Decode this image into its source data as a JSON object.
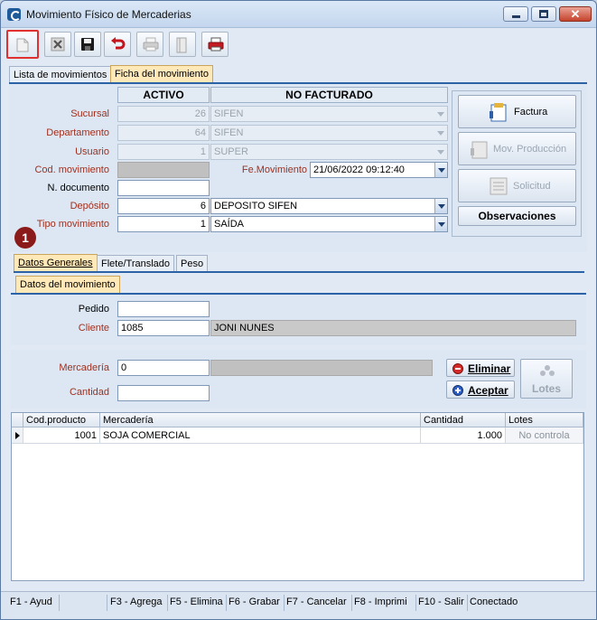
{
  "window": {
    "title": "Movimiento Físico de Mercaderias",
    "close_glyph": "✕"
  },
  "toolbar": {
    "buttons": [
      {
        "name": "new-document-icon",
        "selected": true
      },
      {
        "name": "delete-icon"
      },
      {
        "name": "save-icon"
      },
      {
        "name": "undo-icon"
      },
      {
        "name": "print-icon"
      },
      {
        "name": "book-icon"
      },
      {
        "name": "print-report-icon"
      }
    ]
  },
  "main_tabs": [
    "Lista de movimientos",
    "Ficha del movimiento"
  ],
  "header": {
    "status": "ACTIVO",
    "billing_status": "NO FACTURADO"
  },
  "form": {
    "sucursal": {
      "label": "Sucursal",
      "code": "26",
      "name": "SIFEN"
    },
    "departamento": {
      "label": "Departamento",
      "code": "64",
      "name": "SIFEN"
    },
    "usuario": {
      "label": "Usuario",
      "code": "1",
      "name": "SUPER"
    },
    "cod_movimiento": {
      "label": "Cod. movimiento",
      "value": ""
    },
    "fe_movimiento": {
      "label": "Fe.Movimiento",
      "value": "21/06/2022 09:12:40"
    },
    "n_documento": {
      "label": "N. documento",
      "value": ""
    },
    "deposito": {
      "label": "Depósito",
      "code": "6",
      "name": "DEPOSITO SIFEN"
    },
    "tipo_movimiento": {
      "label": "Tipo movimiento",
      "code": "1",
      "name": "SAÍDA"
    }
  },
  "side_buttons": {
    "factura": "Factura",
    "mov_produccion": "Mov. Producción",
    "solicitud": "Solicitud",
    "observaciones": "Observaciones"
  },
  "step_badge": "1",
  "sub_tabs": [
    "Datos Generales",
    "Flete/Translado",
    "Peso"
  ],
  "section_tab": "Datos del movimiento",
  "datos": {
    "pedido": {
      "label": "Pedido",
      "value": ""
    },
    "cliente": {
      "label": "Cliente",
      "code": "1085",
      "name": "JONI NUNES"
    }
  },
  "item_entry": {
    "mercaderia": {
      "label": "Mercadería",
      "value": "0",
      "description": ""
    },
    "cantidad": {
      "label": "Cantidad",
      "value": ""
    },
    "eliminar": "Eliminar",
    "aceptar": "Aceptar",
    "lotes": "Lotes"
  },
  "grid": {
    "columns": [
      "Cod.producto",
      "Mercadería",
      "Cantidad",
      "Lotes"
    ],
    "rows": [
      {
        "cod": "1001",
        "mercaderia": "SOJA COMERCIAL",
        "cantidad": "1.000",
        "lotes": "No controla"
      }
    ]
  },
  "statusbar": [
    "F1 - Ayud",
    "F3 - Agrega",
    "F5 - Elimina",
    "F6 - Grabar",
    "F7 - Cancelar",
    "F8 - Imprimi",
    "F10 - Salir",
    "Conectado"
  ],
  "colors": {
    "label_red": "#a0301f",
    "selection_red": "#e03030",
    "band_blue": "#2c62a6",
    "badge": "#8b1a1a"
  }
}
